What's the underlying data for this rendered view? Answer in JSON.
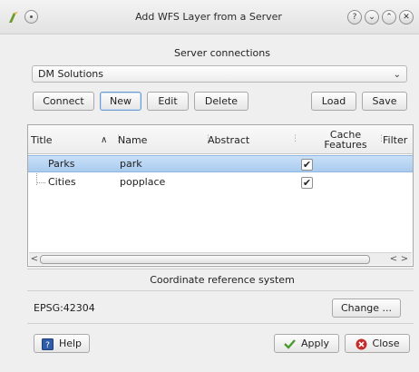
{
  "window": {
    "title": "Add WFS Layer from a Server",
    "buttons": {
      "help": "?",
      "minimize": "⌄",
      "maximize": "⌃",
      "close": "✕"
    }
  },
  "server_connections": {
    "heading": "Server connections",
    "selected": "DM Solutions",
    "buttons": {
      "connect": "Connect",
      "new": "New",
      "edit": "Edit",
      "delete": "Delete",
      "load": "Load",
      "save": "Save"
    }
  },
  "layers_table": {
    "columns": [
      "Title",
      "Name",
      "Abstract",
      "Cache Features",
      "Filter"
    ],
    "cache_header_line1": "Cache",
    "cache_header_line2": "Features",
    "sort_indicator": "∧",
    "rows": [
      {
        "title": "Parks",
        "name": "park",
        "abstract": "",
        "cache_features": true,
        "selected": true
      },
      {
        "title": "Cities",
        "name": "popplace",
        "abstract": "",
        "cache_features": true,
        "selected": false
      }
    ]
  },
  "crs": {
    "heading": "Coordinate reference system",
    "value": "EPSG:42304",
    "change_button": "Change ..."
  },
  "footer": {
    "help": "Help",
    "apply": "Apply",
    "close": "Close"
  },
  "colors": {
    "selection": "#a9cbef",
    "apply_icon": "#4b9a2e",
    "close_icon": "#c62a2a",
    "help_icon": "#2f5ea8"
  }
}
